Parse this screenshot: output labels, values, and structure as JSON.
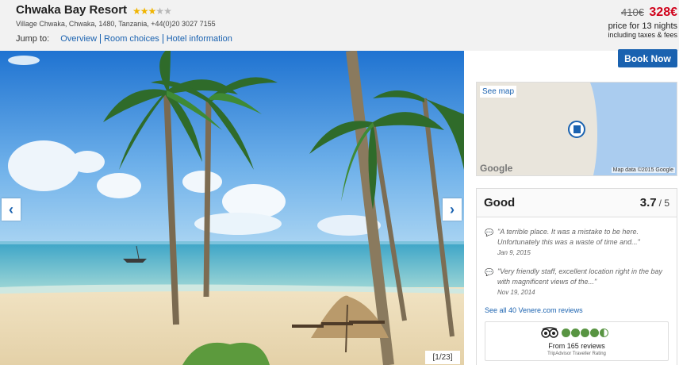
{
  "hotel": {
    "name": "Chwaka Bay Resort",
    "stars": 3,
    "max_stars": 5,
    "address": "Village Chwaka, Chwaka, 1480, Tanzania, +44(0)20 3027 7155"
  },
  "jump_to": {
    "label": "Jump to:",
    "links": [
      "Overview",
      "Room choices",
      "Hotel information"
    ]
  },
  "price": {
    "old": "410€",
    "new": "328€",
    "nights_text": "price for 13 nights",
    "fees_text": "including taxes & fees"
  },
  "book_button": "Book Now",
  "gallery": {
    "counter": "[1/23]",
    "prev_icon": "chevron-left-icon",
    "next_icon": "chevron-right-icon"
  },
  "map": {
    "see_map": "See map",
    "logo": "Google",
    "attribution": "Map data ©2015 Google"
  },
  "reviews": {
    "rating_word": "Good",
    "score": "3.7",
    "score_max": "/ 5",
    "items": [
      {
        "text": "\"A terrible place. It was a mistake to be here. Unfortunately this was a waste of time and...\"",
        "date": "Jan 9, 2015"
      },
      {
        "text": "\"Very friendly staff, excellent location right in the bay with magnificent views of the...\"",
        "date": "Nov 19, 2014"
      }
    ],
    "see_all": "See all 40 Venere.com reviews"
  },
  "tripadvisor": {
    "rating": 4.5,
    "reviews_text": "From 165 reviews",
    "subtitle": "TripAdvisor Traveller Rating"
  },
  "colors": {
    "accent": "#1a62b0",
    "price_red": "#d0021b",
    "star": "#f0b400",
    "tripadvisor_green": "#589442"
  }
}
